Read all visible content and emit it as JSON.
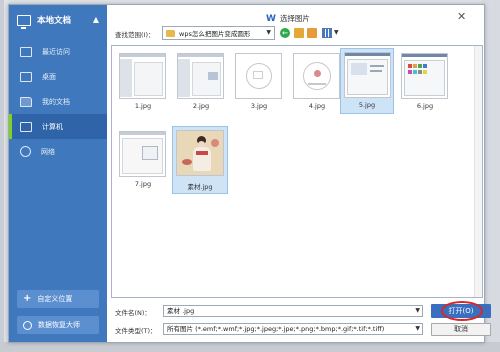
{
  "sidebar": {
    "header": "本地文档",
    "items": [
      {
        "label": "最近访问"
      },
      {
        "label": "桌面"
      },
      {
        "label": "我的文档"
      },
      {
        "label": "计算机",
        "active": true
      },
      {
        "label": "网络"
      }
    ],
    "custom_location_label": "自定义位置",
    "data_recovery_label": "数据恢复大师"
  },
  "dialog": {
    "title": "选择图片",
    "title_icon": "wps-icon",
    "close_glyph": "✕"
  },
  "toolbar": {
    "look_in_label": "查找范围(I)：",
    "current_folder": "wps怎么把图片变成圆形",
    "icons": [
      "back-icon",
      "up-folder-icon",
      "new-folder-icon",
      "view-menu-icon"
    ]
  },
  "files": [
    {
      "name": "1.jpg",
      "selected": false
    },
    {
      "name": "2.jpg",
      "selected": false
    },
    {
      "name": "3.jpg",
      "selected": false
    },
    {
      "name": "4.jpg",
      "selected": false
    },
    {
      "name": "5.jpg",
      "selected": true
    },
    {
      "name": "6.jpg",
      "selected": false
    },
    {
      "name": "7.jpg",
      "selected": false
    },
    {
      "name": "素材.jpg",
      "selected": true
    }
  ],
  "filename": {
    "label": "文件名(N)：",
    "value": "素材 .jpg"
  },
  "filetype": {
    "label": "文件类型(T)：",
    "value": "所有图片 (*.emf;*.wmf;*.jpg;*.jpeg;*.jpe;*.png;*.bmp;*.gif;*.tif;*.tiff)"
  },
  "buttons": {
    "open_label": "打开(O)",
    "cancel_label": "取消"
  },
  "colors": {
    "sidebar_bg": "#3f78bd",
    "active_marker": "#7ed321",
    "selection_bg": "#cfe3f7",
    "open_button": "#3a6fc0",
    "annotation_ring": "#d62828"
  }
}
